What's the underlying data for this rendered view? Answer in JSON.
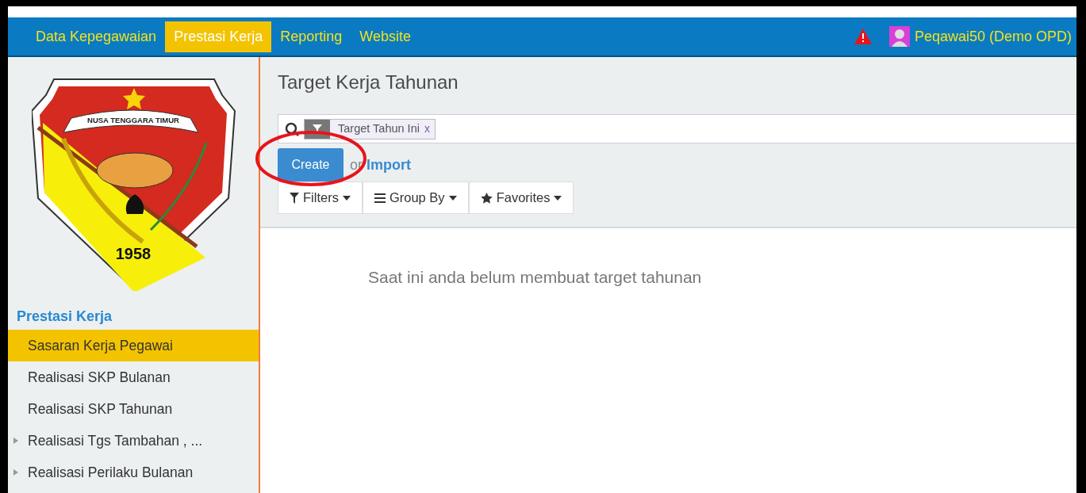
{
  "navbar": {
    "menus": [
      {
        "label": "Data Kepegawaian",
        "selected": false
      },
      {
        "label": "Prestasi Kerja",
        "selected": true
      },
      {
        "label": "Reporting",
        "selected": false
      },
      {
        "label": "Website",
        "selected": false
      }
    ],
    "user": {
      "name": "Peqawai50 (Demo OPD)"
    }
  },
  "sidebar": {
    "logo": {
      "banner_text": "NUSA TENGGARA TIMUR",
      "year": "1958"
    },
    "section_title": "Prestasi Kerja",
    "items": [
      {
        "label": "Sasaran Kerja Pegawai",
        "selected": true,
        "expandable": false
      },
      {
        "label": "Realisasi SKP Bulanan",
        "selected": false,
        "expandable": false
      },
      {
        "label": "Realisasi SKP Tahunan",
        "selected": false,
        "expandable": false
      },
      {
        "label": "Realisasi Tgs Tambahan , ...",
        "selected": false,
        "expandable": true
      },
      {
        "label": "Realisasi Perilaku Bulanan",
        "selected": false,
        "expandable": true
      }
    ]
  },
  "main": {
    "title": "Target Kerja Tahunan",
    "search": {
      "facets": [
        {
          "label": "Target Tahun Ini",
          "remove": "x"
        }
      ]
    },
    "create_button": "Create",
    "or_text": "or",
    "import_link": "Import",
    "search_buttons": [
      {
        "kind": "filter",
        "label": "Filters"
      },
      {
        "kind": "group",
        "label": "Group By"
      },
      {
        "kind": "favorites",
        "label": "Favorites"
      }
    ],
    "empty_message": "Saat ini anda belum membuat target tahunan"
  }
}
